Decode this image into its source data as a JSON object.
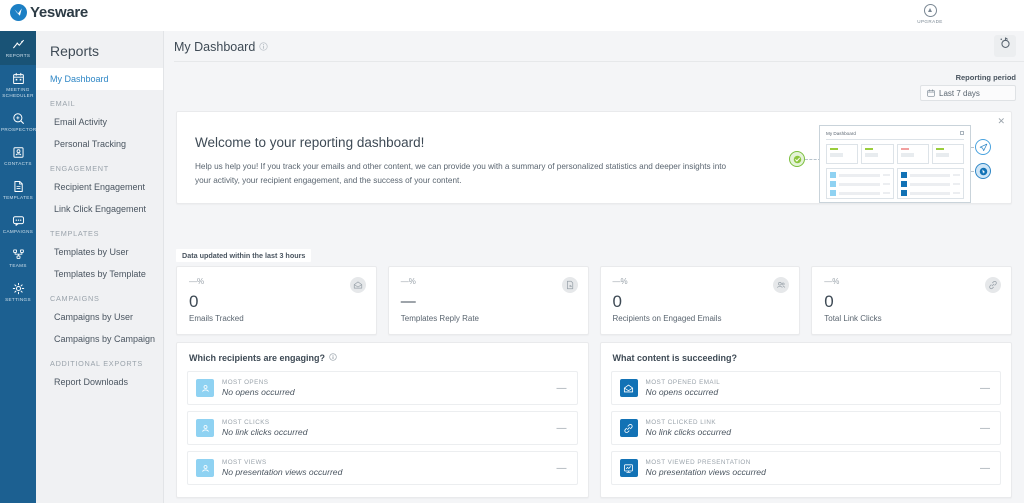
{
  "app": {
    "brand": "Yesware",
    "upgrade_label": "UPGRADE",
    "upgrade_icon": "upgrade-arrow-icon"
  },
  "rail": {
    "items": [
      {
        "label": "REPORTS",
        "icon": "chart-line-icon",
        "active": true
      },
      {
        "label": "MEETING SCHEDULER",
        "icon": "calendar-icon",
        "active": false
      },
      {
        "label": "PROSPECTOR",
        "icon": "magnifier-icon",
        "active": false
      },
      {
        "label": "CONTACTS",
        "icon": "contact-card-icon",
        "active": false
      },
      {
        "label": "TEMPLATES",
        "icon": "document-icon",
        "active": false
      },
      {
        "label": "CAMPAIGNS",
        "icon": "speech-bubble-icon",
        "active": false
      },
      {
        "label": "TEAMS",
        "icon": "org-chart-icon",
        "active": false
      },
      {
        "label": "SETTINGS",
        "icon": "gear-icon",
        "active": false
      }
    ]
  },
  "nav": {
    "title": "Reports",
    "sections": [
      {
        "group": null,
        "items": [
          {
            "label": "My Dashboard",
            "selected": true
          }
        ]
      },
      {
        "group": "EMAIL",
        "items": [
          {
            "label": "Email Activity"
          },
          {
            "label": "Personal Tracking"
          }
        ]
      },
      {
        "group": "ENGAGEMENT",
        "items": [
          {
            "label": "Recipient Engagement"
          },
          {
            "label": "Link Click Engagement"
          }
        ]
      },
      {
        "group": "TEMPLATES",
        "items": [
          {
            "label": "Templates by User"
          },
          {
            "label": "Templates by Template"
          }
        ]
      },
      {
        "group": "CAMPAIGNS",
        "items": [
          {
            "label": "Campaigns by User"
          },
          {
            "label": "Campaigns by Campaign"
          }
        ]
      },
      {
        "group": "ADDITIONAL EXPORTS",
        "items": [
          {
            "label": "Report Downloads"
          }
        ]
      }
    ]
  },
  "page": {
    "title": "My Dashboard",
    "title_info_icon": "info-circle-icon",
    "action_icon": "customize-dashboard-icon"
  },
  "period": {
    "label": "Reporting period",
    "value": "Last 7 days",
    "icon": "calendar-icon"
  },
  "banner": {
    "heading": "Welcome to your reporting dashboard!",
    "body": "Help us help you! If you track your emails and other content, we can provide you with a summary of personalized statistics and deeper insights into your activity, your recipient engagement, and the success of your content.",
    "close_icon": "close-icon",
    "illustration": {
      "mock_title": "My Dashboard",
      "badge_green": "check-badge-icon",
      "badge_send": "paper-plane-icon",
      "badge_click": "click-cursor-icon"
    }
  },
  "updated_notice": "Data updated within the last 3 hours",
  "kpis": [
    {
      "delta": "—%",
      "value": "0",
      "caption": "Emails Tracked",
      "icon": "envelope-open-icon"
    },
    {
      "delta": "—%",
      "value": "—",
      "caption": "Templates Reply Rate",
      "icon": "reply-document-icon",
      "is_dash": true
    },
    {
      "delta": "—%",
      "value": "0",
      "caption": "Recipients on Engaged Emails",
      "icon": "people-icon"
    },
    {
      "delta": "—%",
      "value": "0",
      "caption": "Total Link Clicks",
      "icon": "link-icon"
    }
  ],
  "panels": [
    {
      "heading": "Which recipients are engaging?",
      "has_info": true,
      "info_icon": "info-circle-icon",
      "rows": [
        {
          "key": "MOST OPENS",
          "value": "No opens occurred",
          "icon": "person-icon",
          "tone": "light",
          "trailing": "—"
        },
        {
          "key": "MOST CLICKS",
          "value": "No link clicks occurred",
          "icon": "person-icon",
          "tone": "light",
          "trailing": "—"
        },
        {
          "key": "MOST VIEWS",
          "value": "No presentation views occurred",
          "icon": "person-icon",
          "tone": "light",
          "trailing": "—"
        }
      ]
    },
    {
      "heading": "What content is succeeding?",
      "has_info": false,
      "rows": [
        {
          "key": "MOST OPENED EMAIL",
          "value": "No opens occurred",
          "icon": "envelope-open-icon",
          "tone": "dark",
          "trailing": "—"
        },
        {
          "key": "MOST CLICKED LINK",
          "value": "No link clicks occurred",
          "icon": "link-icon",
          "tone": "dark",
          "trailing": "—"
        },
        {
          "key": "MOST VIEWED PRESENTATION",
          "value": "No presentation views occurred",
          "icon": "presentation-icon",
          "tone": "dark",
          "trailing": "—"
        }
      ]
    }
  ],
  "colors": {
    "rail": "#1c6091",
    "accent": "#2f87c6",
    "icon_dark": "#1272b5",
    "icon_light": "#8fd2f2",
    "page_bg": "#f4f5f7"
  }
}
